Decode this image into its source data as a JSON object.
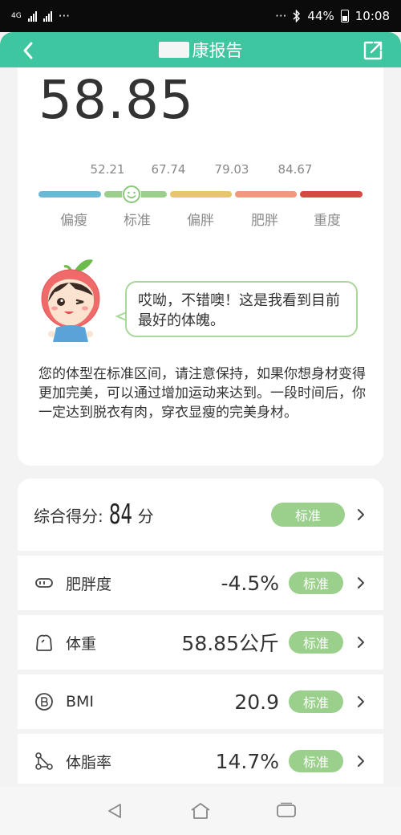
{
  "status_bar": {
    "left_net": "4G",
    "more_left": "···",
    "more_right": "···",
    "battery_pct": "44%",
    "time": "10:08"
  },
  "header": {
    "title": "康报告",
    "back_icon": "chevron-left-icon",
    "share_icon": "share-external-icon",
    "color": "#3ec6a0"
  },
  "main": {
    "weight": "58.85",
    "thresholds": [
      "52.21",
      "67.74",
      "79.03",
      "84.67"
    ],
    "categories": [
      "偏瘦",
      "标准",
      "偏胖",
      "肥胖",
      "重度"
    ],
    "category_colors": [
      "#6bb8d6",
      "#9bd08c",
      "#e8c56c",
      "#ee9a7c",
      "#d74a42"
    ],
    "current_category_index": 1,
    "bubble_text": "哎呦，不错噢！这是我看到目前最好的体魄。",
    "description": "您的体型在标准区间，请注意保持，如果你想身材变得更加完美，可以通过增加运动来达到。一段时间后，你一定达到脱衣有肉，穿衣显瘦的完美身材。"
  },
  "score": {
    "label": "综合得分:",
    "value": "84",
    "unit": "分",
    "badge": "标准"
  },
  "metrics": [
    {
      "icon": "body-fat-degree-icon",
      "name": "肥胖度",
      "value": "-4.5%",
      "badge": "标准"
    },
    {
      "icon": "weight-scale-icon",
      "name": "体重",
      "value": "58.85公斤",
      "badge": "标准"
    },
    {
      "icon": "bmi-icon",
      "name": "BMI",
      "value": "20.9",
      "badge": "标准"
    },
    {
      "icon": "body-fat-rate-icon",
      "name": "体脂率",
      "value": "14.7%",
      "badge": "标准"
    }
  ],
  "nav": {
    "back": "triangle-back-icon",
    "home": "home-icon",
    "recents": "recents-icon"
  }
}
